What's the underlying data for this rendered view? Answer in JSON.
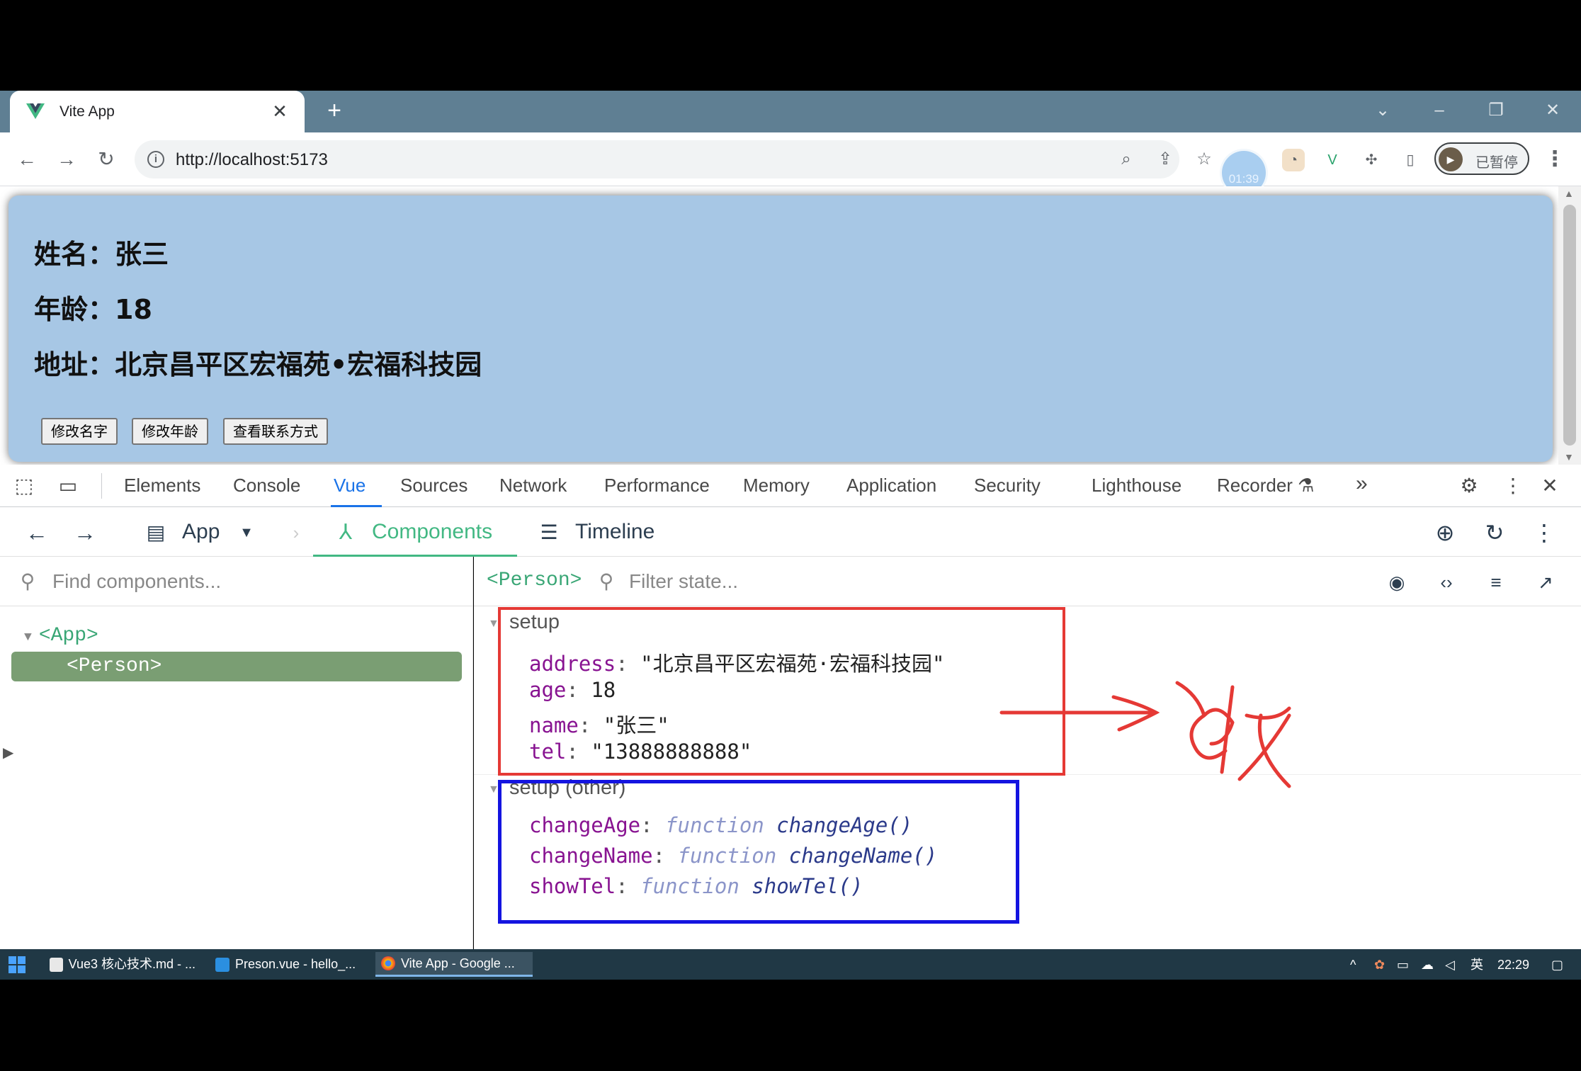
{
  "browser": {
    "tab_title": "Vite App",
    "tab_close": "✕",
    "new_tab": "+",
    "url": "http://localhost:5173",
    "timer": "01:39",
    "profile_label": "已暂停"
  },
  "page": {
    "name_line": "姓名：张三",
    "age_line": "年龄：18",
    "address_line": "地址：北京昌平区宏福苑•宏福科技园",
    "buttons": [
      "修改名字",
      "修改年龄",
      "查看联系方式"
    ]
  },
  "devtools": {
    "tabs": [
      "Elements",
      "Console",
      "Vue",
      "Sources",
      "Network",
      "Performance",
      "Memory",
      "Application",
      "Security",
      "Lighthouse",
      "Recorder"
    ],
    "active_tab": "Vue",
    "more": "»"
  },
  "vue": {
    "app_label": "App",
    "components_label": "Components",
    "timeline_label": "Timeline",
    "find_placeholder": "Find components...",
    "tree_app": "<App>",
    "tree_person": "<Person>",
    "selected": "<Person>",
    "filter_placeholder": "Filter state...",
    "setup_title": "setup",
    "setup_other_title": "setup (other)",
    "setup": [
      {
        "key": "address",
        "value": "\"北京昌平区宏福苑·宏福科技园\""
      },
      {
        "key": "age",
        "value": "18"
      },
      {
        "key": "name",
        "value": "\"张三\""
      },
      {
        "key": "tel",
        "value": "\"13888888888\""
      }
    ],
    "functions": [
      {
        "key": "changeAge",
        "kw": "function",
        "name": "changeAge()"
      },
      {
        "key": "changeName",
        "kw": "function",
        "name": "changeName()"
      },
      {
        "key": "showTel",
        "kw": "function",
        "name": "showTel()"
      }
    ]
  },
  "annotation": {
    "red_box_color": "#e53935",
    "blue_box_color": "#1414e0"
  },
  "taskbar": {
    "items": [
      "Vue3 核心技术.md - ...",
      "Preson.vue - hello_...",
      "Vite App - Google ..."
    ],
    "ime": "英",
    "clock": "22:29"
  }
}
